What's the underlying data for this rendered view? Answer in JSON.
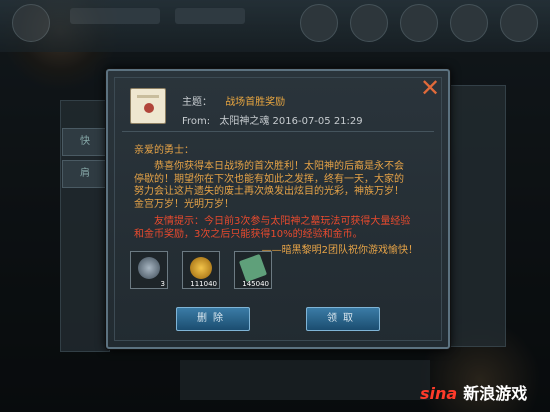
{
  "dialog": {
    "subject_label": "主题：",
    "subject_value": "战场首胜奖励",
    "from_label": "From:",
    "from_value": "太阳神之魂 2016-07-05 21:29",
    "greeting": "亲爱的勇士：",
    "body_lines": [
      "恭喜你获得本日战场的首次胜利！太阳神的后裔是永不会",
      "停歇的！期望你在下次也能有如此之发挥，终有一天，大家的",
      "努力会让这片遗失的废土再次焕发出炫目的光彩，神族万岁！",
      "金宫万岁！光明万岁！"
    ],
    "tip_lines": [
      "友情提示：今日前3次参与太阳神之墓玩法可获得大量经验",
      "和金币奖励，3次之后只能获得10%的经验和金币。"
    ],
    "signature": "——暗黑黎明2团队祝你游戏愉快！",
    "items": [
      {
        "icon": "badge-icon",
        "count": "3"
      },
      {
        "icon": "gold-coin-icon",
        "count": "111040"
      },
      {
        "icon": "exp-book-icon",
        "count": "145040"
      }
    ],
    "delete_label": "删除",
    "claim_label": "领取",
    "close_icon": "close-icon"
  },
  "background": {
    "left_tabs": [
      "快",
      "肩"
    ]
  },
  "watermark": {
    "brand": "sina",
    "text": "新浪游戏"
  },
  "colors": {
    "accent_orange": "#e6a347",
    "tip_red": "#e84a2e",
    "close_red": "#e06a3a",
    "button_blue": "#2f6f98"
  }
}
